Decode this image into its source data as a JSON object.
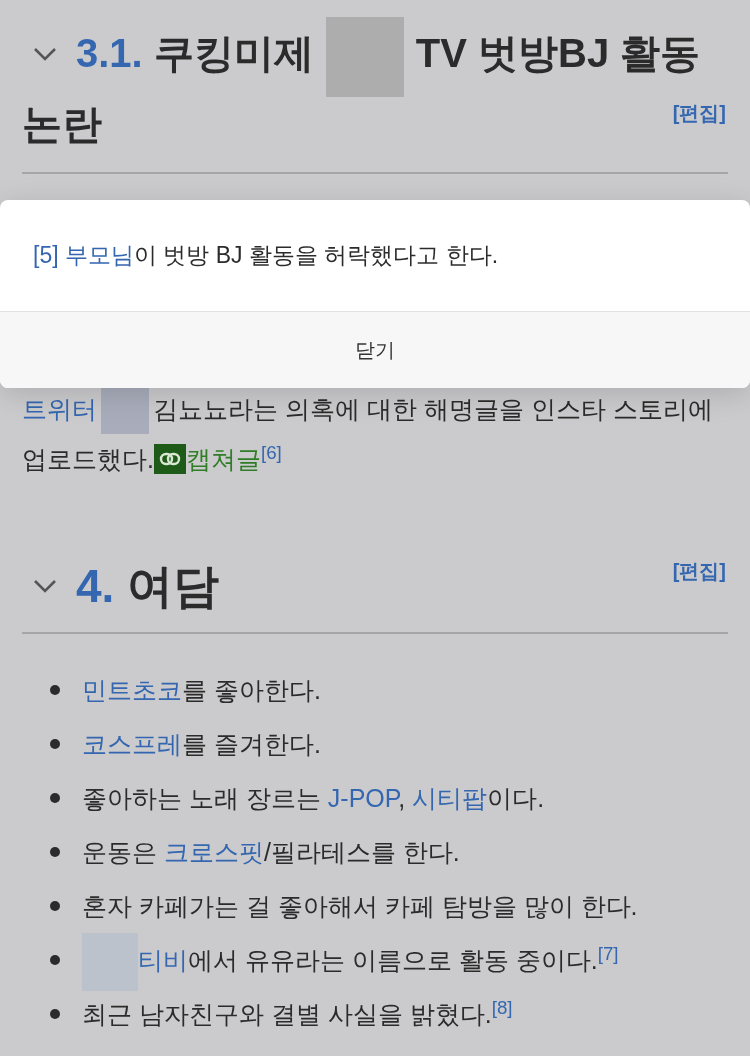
{
  "section_heading": {
    "number": "3.1.",
    "lines": [
      [
        {
          "kind": "text",
          "text": "쿠킹미제"
        },
        {
          "kind": "redacted"
        },
        {
          "kind": "text",
          "text": "TV 벗방BJ 활동"
        }
      ],
      [
        {
          "kind": "text",
          "text": "논란"
        }
      ]
    ],
    "edit_link": "[편집]",
    "expanded": true
  },
  "paragraph": {
    "lines": [
      [
        {
          "kind": "link",
          "text": "트위터"
        },
        {
          "kind": "redacted"
        },
        {
          "kind": "text",
          "text": "김뇨뇨라는 의혹에 대한 해명글을 인스타 스토리에"
        }
      ],
      [
        {
          "kind": "text",
          "text": "업로드했다."
        },
        {
          "kind": "external",
          "text": "캡쳐글"
        },
        {
          "kind": "ref",
          "text": "[6]"
        }
      ]
    ]
  },
  "trivia_heading": {
    "number": "4.",
    "title": "여담",
    "edit_link": "[편집]",
    "expanded": true
  },
  "trivia_items": [
    [
      {
        "kind": "link",
        "text": "민트초코"
      },
      {
        "kind": "text",
        "text": "를 좋아한다."
      }
    ],
    [
      {
        "kind": "link",
        "text": "코스프레"
      },
      {
        "kind": "text",
        "text": "를 즐겨한다."
      }
    ],
    [
      {
        "kind": "text",
        "text": "좋아하는 노래 장르는 "
      },
      {
        "kind": "link",
        "text": "J-POP"
      },
      {
        "kind": "text",
        "text": ", "
      },
      {
        "kind": "link",
        "text": "시티팝"
      },
      {
        "kind": "text",
        "text": "이다."
      }
    ],
    [
      {
        "kind": "text",
        "text": "운동은 "
      },
      {
        "kind": "link",
        "text": "크로스핏"
      },
      {
        "kind": "text",
        "text": "/필라테스를 한다."
      }
    ],
    [
      {
        "kind": "text",
        "text": "혼자 카페가는 걸 좋아해서 카페 탐방을 많이 한다."
      }
    ],
    [
      {
        "kind": "redacted"
      },
      {
        "kind": "link",
        "text": "티비"
      },
      {
        "kind": "text",
        "text": "에서 유유라는 이름으로 활동 중이다."
      },
      {
        "kind": "ref",
        "text": "[7]"
      }
    ],
    [
      {
        "kind": "text",
        "text": "최근 남자친구와 결별 사실을 밝혔다."
      },
      {
        "kind": "ref",
        "text": "[8]"
      }
    ]
  ],
  "footnote_popup": {
    "ref": "[5]",
    "segments": [
      {
        "kind": "link",
        "text": "부모님"
      },
      {
        "kind": "text",
        "text": "이 벗방 BJ 활동을 허락했다고 한다."
      }
    ],
    "close_button": "닫기"
  }
}
